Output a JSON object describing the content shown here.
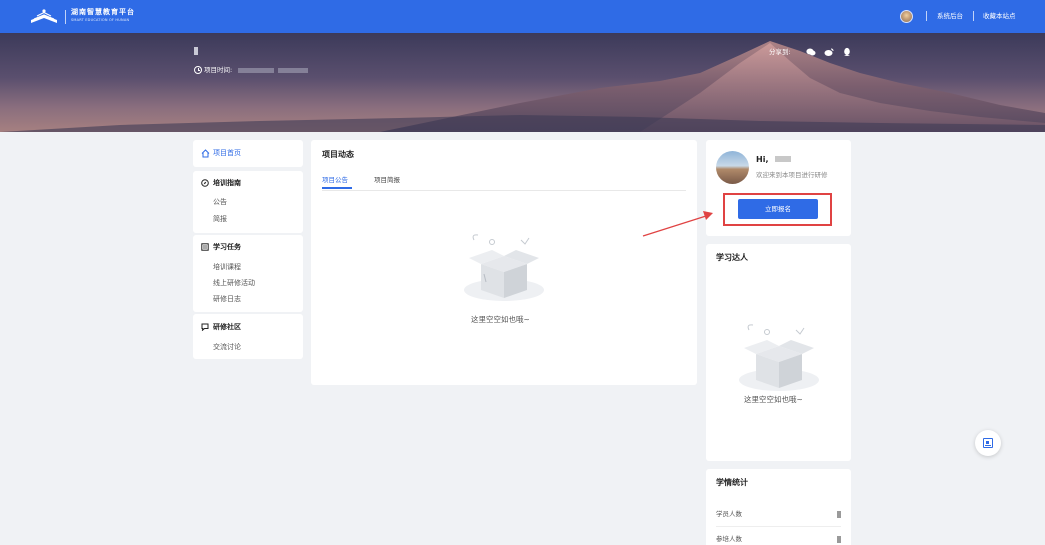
{
  "colors": {
    "brand": "#2f6be6",
    "highlight": "#e04343",
    "page_bg": "#f0f2f5"
  },
  "header": {
    "logo_icon": "open-book-logo-icon",
    "logo_cn": "湖南智慧教育平台",
    "logo_en": "SMART EDUCATION OF HUNAN",
    "links": [
      "系统后台",
      "收藏本站点"
    ]
  },
  "banner": {
    "project_time_label": "项目时间:",
    "share_label": "分享到:",
    "share_icons": [
      "wechat-icon",
      "weibo-icon",
      "qq-icon"
    ]
  },
  "sidebar": {
    "home": {
      "icon": "home-icon",
      "label": "项目首页"
    },
    "sections": [
      {
        "icon": "guide-icon",
        "title": "培训指南",
        "items": [
          "公告",
          "简报"
        ]
      },
      {
        "icon": "task-icon",
        "title": "学习任务",
        "items": [
          "培训课程",
          "线上研修活动",
          "研修日志"
        ]
      },
      {
        "icon": "community-icon",
        "title": "研修社区",
        "items": [
          "交流讨论"
        ]
      }
    ]
  },
  "main": {
    "title": "项目动态",
    "tabs": [
      {
        "label": "项目公告",
        "active": true
      },
      {
        "label": "项目简报",
        "active": false
      }
    ],
    "empty_text": "这里空空如也哦~"
  },
  "user_card": {
    "greeting": "Hi,",
    "welcome": "欢迎来到本项目进行研修",
    "signup_label": "立即报名"
  },
  "learning_stars": {
    "title": "学习达人",
    "empty_text": "这里空空如也哦~"
  },
  "stats": {
    "title": "学情统计",
    "rows": [
      {
        "label": "学员人数"
      },
      {
        "label": "参培人数"
      }
    ]
  },
  "float_button": {
    "icon": "qrcode-icon"
  }
}
